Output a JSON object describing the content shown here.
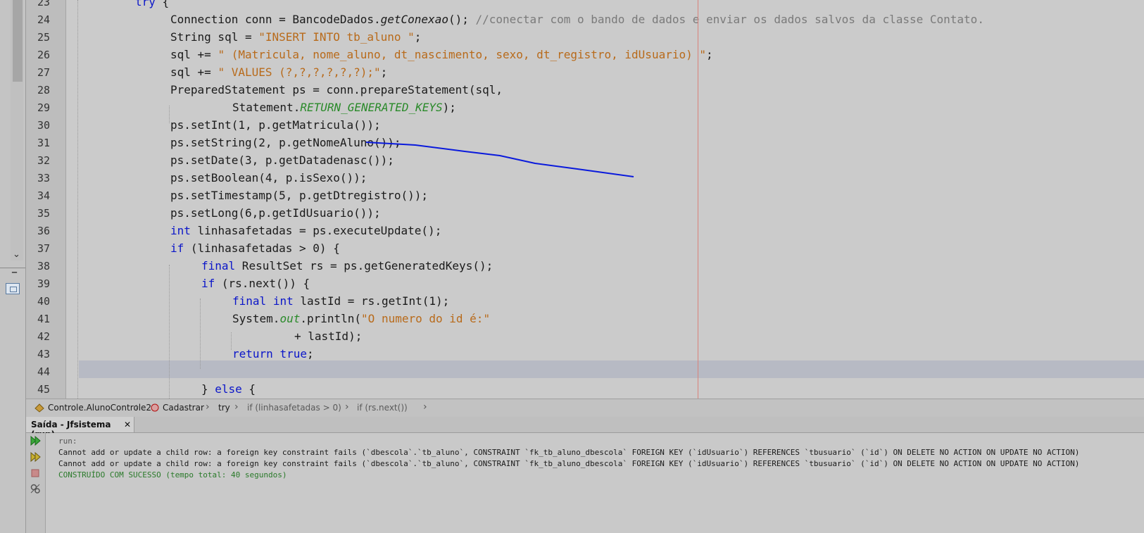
{
  "editor": {
    "lines": [
      {
        "num": "23",
        "indent": 192,
        "tokens": [
          {
            "t": "try",
            "c": "kw"
          },
          {
            "t": " {",
            "c": ""
          }
        ]
      },
      {
        "num": "24",
        "indent": 242,
        "tokens": [
          {
            "t": "Connection conn = BancodeDados.",
            "c": ""
          },
          {
            "t": "getConexao",
            "c": "it"
          },
          {
            "t": "(); ",
            "c": ""
          },
          {
            "t": "//conectar com o bando de dados e enviar os dados salvos da classe Contato.",
            "c": "cm"
          }
        ]
      },
      {
        "num": "25",
        "indent": 242,
        "tokens": [
          {
            "t": "String sql = ",
            "c": ""
          },
          {
            "t": "\"INSERT INTO tb_aluno \"",
            "c": "str"
          },
          {
            "t": ";",
            "c": ""
          }
        ]
      },
      {
        "num": "26",
        "indent": 242,
        "tokens": [
          {
            "t": "sql += ",
            "c": ""
          },
          {
            "t": "\" (Matricula, nome_aluno, dt_nascimento, sexo, dt_registro, idUsuario) \"",
            "c": "str"
          },
          {
            "t": ";",
            "c": ""
          }
        ]
      },
      {
        "num": "27",
        "indent": 242,
        "tokens": [
          {
            "t": "sql += ",
            "c": ""
          },
          {
            "t": "\" VALUES (?,?,?,?,?,?);\"",
            "c": "str"
          },
          {
            "t": ";",
            "c": ""
          }
        ]
      },
      {
        "num": "28",
        "indent": 242,
        "tokens": [
          {
            "t": "PreparedStatement ps = conn.prepareStatement(sql,",
            "c": ""
          }
        ]
      },
      {
        "num": "29",
        "indent": 330,
        "tokens": [
          {
            "t": "Statement.",
            "c": ""
          },
          {
            "t": "RETURN_GENERATED_KEYS",
            "c": "grn"
          },
          {
            "t": ");",
            "c": ""
          }
        ]
      },
      {
        "num": "30",
        "indent": 242,
        "tokens": [
          {
            "t": "ps.setInt(1, p.getMatricula());",
            "c": ""
          }
        ]
      },
      {
        "num": "31",
        "indent": 242,
        "tokens": [
          {
            "t": "ps.setString(2, p.getNomeAluno());",
            "c": ""
          }
        ]
      },
      {
        "num": "32",
        "indent": 242,
        "tokens": [
          {
            "t": "ps.setDate(3, p.getDatadenasc());",
            "c": ""
          }
        ]
      },
      {
        "num": "33",
        "indent": 242,
        "tokens": [
          {
            "t": "ps.setBoolean(4, p.isSexo());",
            "c": ""
          }
        ]
      },
      {
        "num": "34",
        "indent": 242,
        "tokens": [
          {
            "t": "ps.setTimestamp(5, p.getDtregistro());",
            "c": ""
          }
        ]
      },
      {
        "num": "35",
        "indent": 242,
        "tokens": [
          {
            "t": "ps.setLong(6,p.getIdUsuario());",
            "c": ""
          }
        ]
      },
      {
        "num": "36",
        "indent": 242,
        "tokens": [
          {
            "t": "int",
            "c": "kw"
          },
          {
            "t": " linhasafetadas = ps.executeUpdate();",
            "c": ""
          }
        ]
      },
      {
        "num": "37",
        "indent": 242,
        "tokens": [
          {
            "t": "if",
            "c": "kw"
          },
          {
            "t": " (linhasafetadas > 0) {",
            "c": ""
          }
        ]
      },
      {
        "num": "38",
        "indent": 286,
        "tokens": [
          {
            "t": "final",
            "c": "kw"
          },
          {
            "t": " ResultSet rs = ps.getGeneratedKeys();",
            "c": ""
          }
        ]
      },
      {
        "num": "39",
        "indent": 286,
        "tokens": [
          {
            "t": "if",
            "c": "kw"
          },
          {
            "t": " (rs.next()) {",
            "c": ""
          }
        ]
      },
      {
        "num": "40",
        "indent": 330,
        "tokens": [
          {
            "t": "final",
            "c": "kw"
          },
          {
            "t": " ",
            "c": ""
          },
          {
            "t": "int",
            "c": "kw"
          },
          {
            "t": " lastId = rs.getInt(1);",
            "c": ""
          }
        ]
      },
      {
        "num": "41",
        "indent": 330,
        "tokens": [
          {
            "t": "System.",
            "c": ""
          },
          {
            "t": "out",
            "c": "grn"
          },
          {
            "t": ".println(",
            "c": ""
          },
          {
            "t": "\"O numero do id é:\"",
            "c": "str"
          }
        ]
      },
      {
        "num": "42",
        "indent": 418,
        "tokens": [
          {
            "t": "+ lastId);",
            "c": ""
          }
        ]
      },
      {
        "num": "43",
        "indent": 330,
        "tokens": [
          {
            "t": "return",
            "c": "kw"
          },
          {
            "t": " ",
            "c": ""
          },
          {
            "t": "true",
            "c": "kw"
          },
          {
            "t": ";",
            "c": ""
          }
        ]
      },
      {
        "num": "44",
        "indent": 330,
        "tokens": []
      },
      {
        "num": "45",
        "indent": 286,
        "tokens": [
          {
            "t": "} ",
            "c": ""
          },
          {
            "t": "else",
            "c": "kw"
          },
          {
            "t": " {",
            "c": ""
          }
        ]
      }
    ]
  },
  "breadcrumb": {
    "class": "Controle.AlunoControle2",
    "method": "Cadastrar",
    "try": "try",
    "if1": "if (linhasafetadas > 0)",
    "if2": "if (rs.next())"
  },
  "output": {
    "tab_label": "Saída - Jfsistema (run)",
    "close": "✕",
    "lines": [
      {
        "text": "run:",
        "color": "#555555"
      },
      {
        "text": "Cannot add or update a child row: a foreign key constraint fails (`dbescola`.`tb_aluno`, CONSTRAINT `fk_tb_aluno_dbescola` FOREIGN KEY (`idUsuario`) REFERENCES `tbusuario` (`id`) ON DELETE NO ACTION ON UPDATE NO ACTION)",
        "color": "#1a1a1a"
      },
      {
        "text": "Cannot add or update a child row: a foreign key constraint fails (`dbescola`.`tb_aluno`, CONSTRAINT `fk_tb_aluno_dbescola` FOREIGN KEY (`idUsuario`) REFERENCES `tbusuario` (`id`) ON DELETE NO ACTION ON UPDATE NO ACTION)",
        "color": "#1a1a1a"
      },
      {
        "text": "CONSTRUÍDO COM SUCESSO (tempo total: 40 segundos)",
        "color": "#2a7a2a"
      }
    ]
  },
  "icons": [
    "run-icon",
    "rerun-icon",
    "stop-icon",
    "settings-icon",
    "navigator-icon",
    "chevron-down-icon"
  ],
  "colors": {
    "keyword": "#0b16c9",
    "string": "#b86a1a",
    "comment": "#7a7a7a",
    "constant": "#2a8a2a",
    "annotation": "#0a1adc"
  }
}
